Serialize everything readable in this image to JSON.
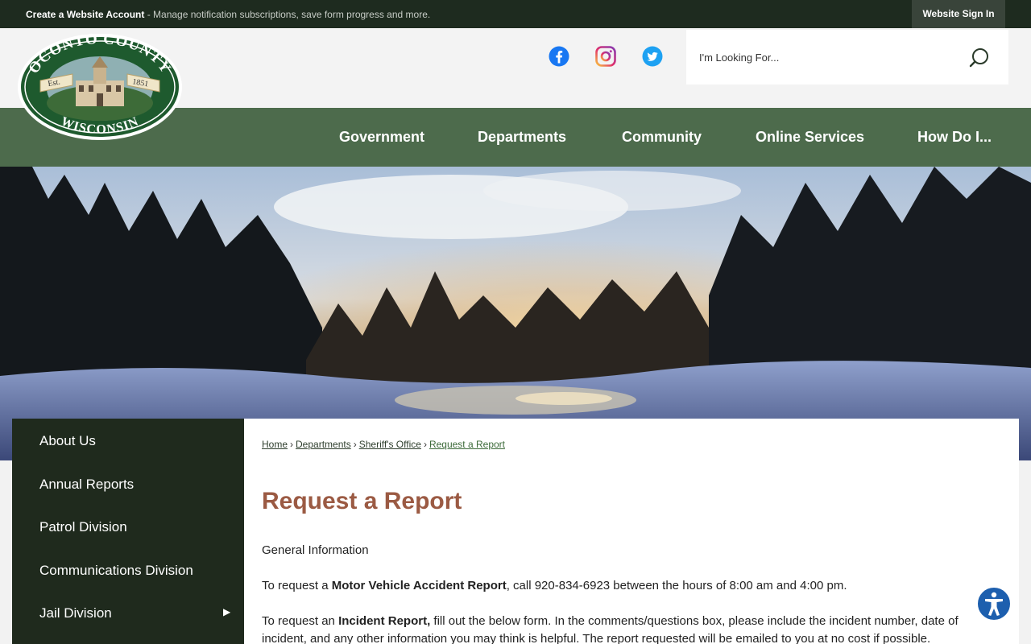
{
  "topbar": {
    "create_account_label": "Create a Website Account",
    "create_account_desc": " - Manage notification subscriptions, save form progress and more.",
    "signin_label": "Website Sign In"
  },
  "logo": {
    "top_text": "OCONTO COUNTY",
    "bottom_text": "WISCONSIN",
    "est_left": "Est.",
    "est_right": "1851"
  },
  "social": [
    "facebook-icon",
    "instagram-icon",
    "twitter-icon"
  ],
  "search": {
    "placeholder": "I'm Looking For..."
  },
  "nav": {
    "items": [
      "Government",
      "Departments",
      "Community",
      "Online Services",
      "How Do I..."
    ]
  },
  "sidebar": {
    "items": [
      "About Us",
      "Annual Reports",
      "Patrol Division",
      "Communications Division",
      "Jail Division"
    ]
  },
  "breadcrumb": [
    "Home",
    "Departments",
    "Sheriff's Office",
    "Request a Report"
  ],
  "main": {
    "title": "Request a Report",
    "general_info": "General Information",
    "p1_prefix": "To request a ",
    "p1_bold": "Motor Vehicle Accident Report",
    "p1_suffix": ", call 920-834-6923 between the hours of 8:00 am and 4:00 pm.",
    "p2_prefix": "To request an ",
    "p2_bold": "Incident Report,",
    "p2_suffix": " fill out the below form. In the comments/questions box, please include the incident number, date of incident, and any other information you may think is helpful. The report requested will be emailed to you at no cost if possible."
  },
  "colors": {
    "topbar_bg": "#1e2b1f",
    "nav_bg": "#4d6b4c",
    "sidebar_bg": "#1f2a1d",
    "title_color": "#9b5a43",
    "accessibility_blue": "#1d5fae"
  }
}
